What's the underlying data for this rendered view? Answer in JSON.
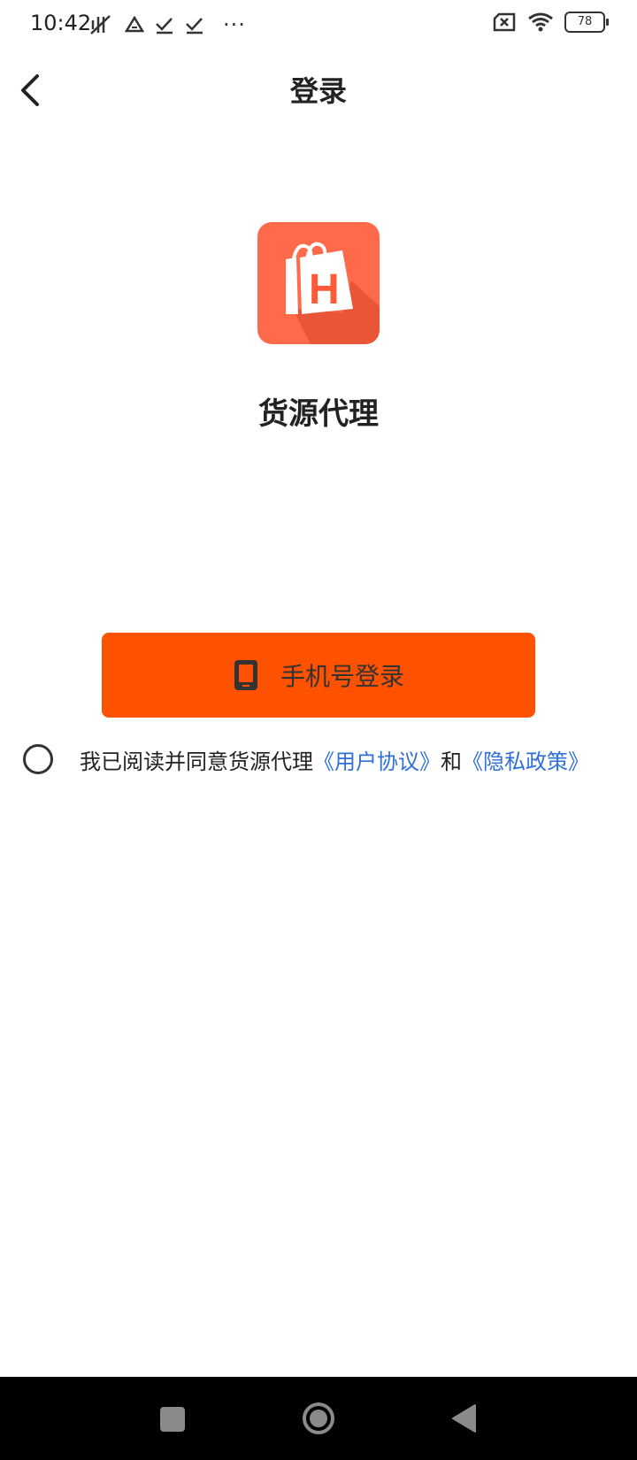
{
  "status_bar": {
    "time": "10:42",
    "left_icons": [
      "mute-vibrate-icon",
      "drive-icon",
      "check-icon",
      "check-icon",
      "more-icon"
    ],
    "more_glyph": "···",
    "battery_level": "78"
  },
  "header": {
    "title": "登录"
  },
  "app": {
    "name": "货源代理",
    "logo_letter": "H",
    "logo_color": "#ff6a4a"
  },
  "login_button": {
    "label": "手机号登录",
    "background": "#ff5200",
    "icon": "phone-icon"
  },
  "agreement": {
    "prefix": "我已阅读并同意货源代理",
    "user_agreement": "《用户协议》",
    "conjunction": "和",
    "privacy_policy": "《隐私政策》",
    "link_color": "#2f6fd8"
  },
  "nav_bar": {
    "buttons": [
      "recent-apps-icon",
      "home-icon",
      "back-icon"
    ]
  }
}
